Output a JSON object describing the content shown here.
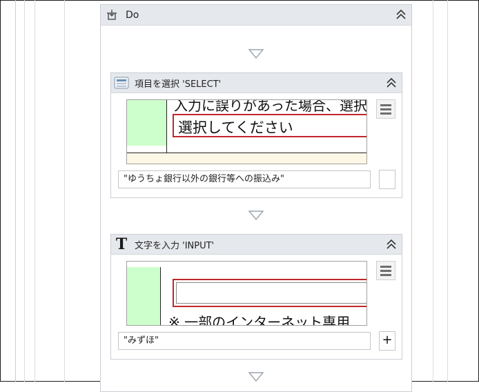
{
  "do_block": {
    "title": "Do"
  },
  "select_activity": {
    "title": "項目を選択 'SELECT'",
    "preview_text_top": "入力に誤りがあった場合、選択",
    "preview_text_main": "選択してください",
    "value": "\"ゆうちょ銀行以外の銀行等への振込み\""
  },
  "input_activity": {
    "title_icon": "T",
    "title": "文字を入力 'INPUT'",
    "preview_text_bottom": "※ 一部のインターネット専用",
    "value": "\"みずほ\"",
    "add_label": "+"
  }
}
